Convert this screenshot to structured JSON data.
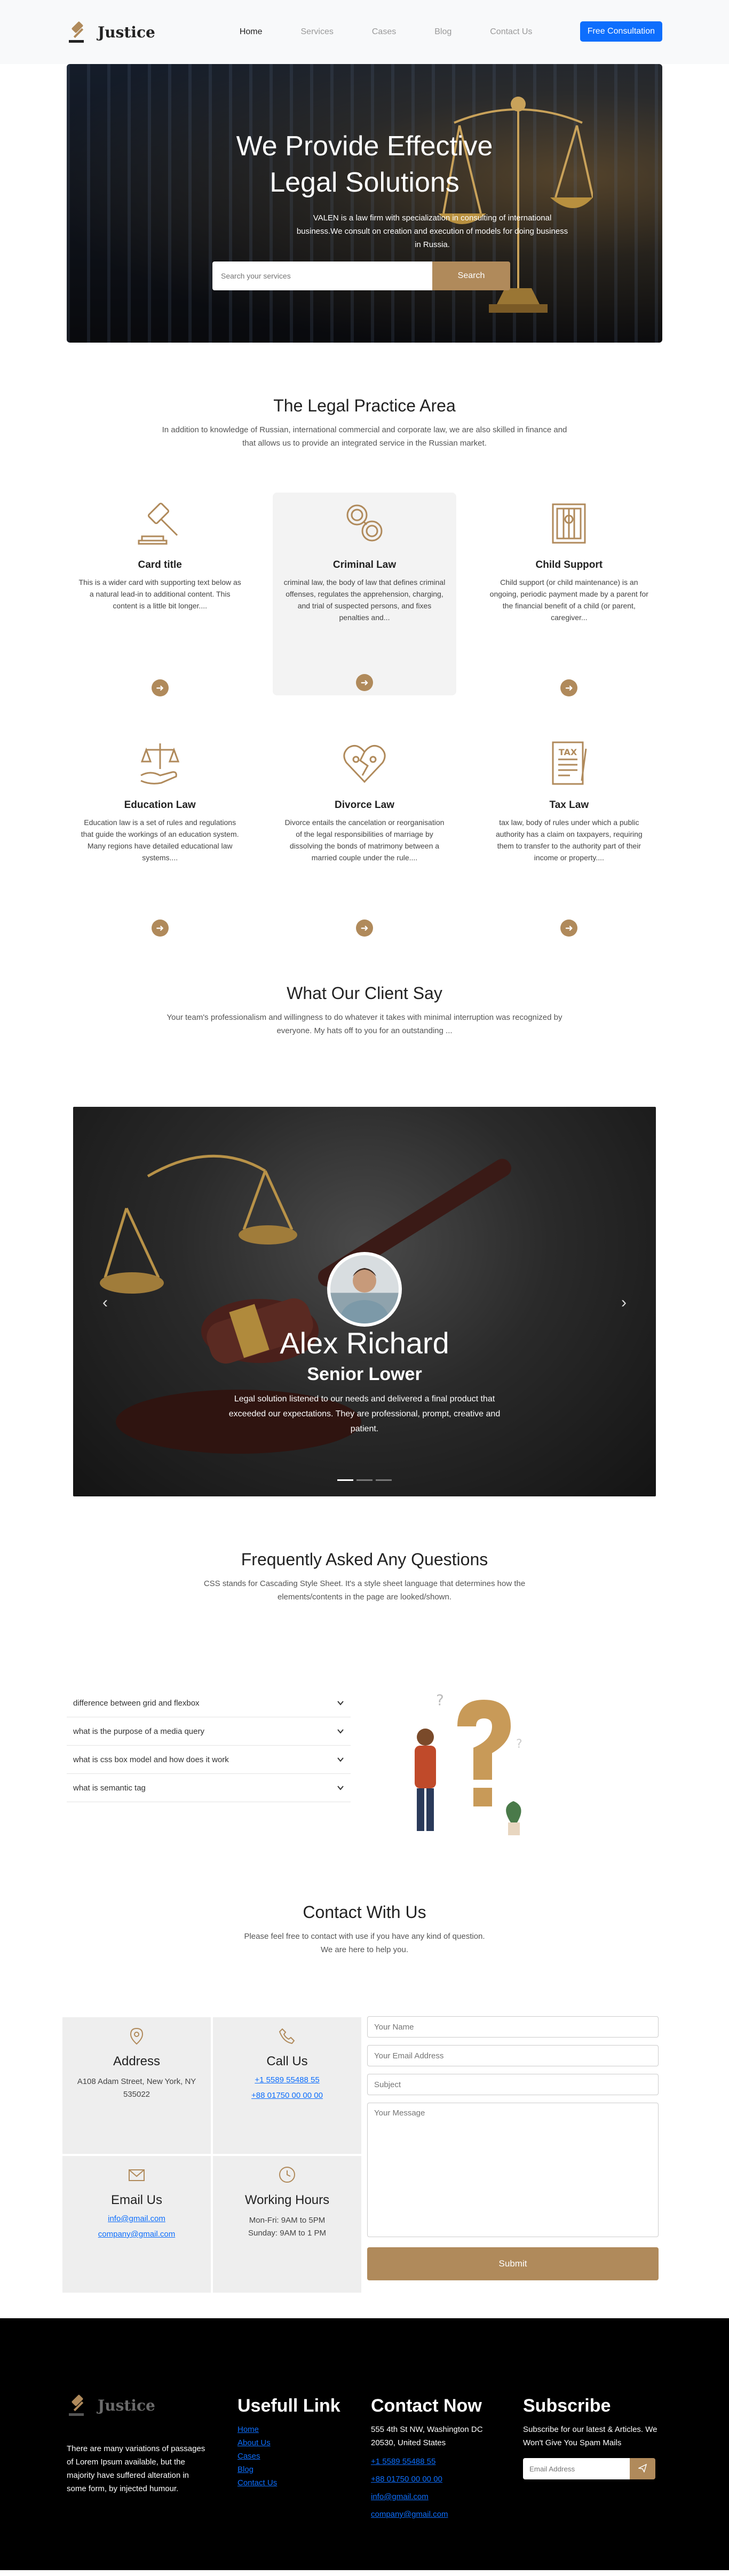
{
  "nav": {
    "brand": "Justice",
    "links": [
      "Home",
      "Services",
      "Cases",
      "Blog",
      "Contact Us"
    ],
    "cta": "Free Consultation"
  },
  "hero": {
    "title_line1": "We Provide Effective",
    "title_line2": "Legal Solutions",
    "text": "VALEN is a law firm with specialization in consulting of international business.We consult on creation and execution of models for doing business in Russia.",
    "search_placeholder": "Search your services",
    "search_button": "Search"
  },
  "practice": {
    "title": "The Legal Practice Area",
    "subtitle": "In addition to knowledge of Russian, international commercial and corporate law, we are also skilled in finance and that allows us to provide an integrated service in the Russian market.",
    "cards": [
      {
        "title": "Card title",
        "text": "This is a wider card with supporting text below as a natural lead-in to additional content. This content is a little bit longer....",
        "icon": "gavel-icon"
      },
      {
        "title": "Criminal Law",
        "text": "criminal law, the body of law that defines criminal offenses, regulates the apprehension, charging, and trial of suspected persons, and fixes penalties and...",
        "icon": "handcuffs-icon"
      },
      {
        "title": "Child Support",
        "text": "Child support (or child maintenance) is an ongoing, periodic payment made by a parent for the financial benefit of a child (or parent, caregiver...",
        "icon": "prison-icon"
      },
      {
        "title": "Education Law",
        "text": "Education law is a set of rules and regulations that guide the workings of an education system. Many regions have detailed educational law systems....",
        "icon": "hand-scale-icon"
      },
      {
        "title": "Divorce Law",
        "text": "Divorce entails the cancelation or reorganisation of the legal responsibilities of marriage by dissolving the bonds of matrimony between a married couple under the rule....",
        "icon": "broken-heart-icon"
      },
      {
        "title": "Tax Law",
        "text": "tax law, body of rules under which a public authority has a claim on taxpayers, requiring them to transfer to the authority part of their income or property....",
        "icon": "tax-document-icon"
      }
    ],
    "arrow": "➜"
  },
  "testimonial": {
    "title": "What Our Client Say",
    "subtitle": "Your team's professionalism and willingness to do whatever it takes with minimal interruption was recognized by everyone. My hats off to you for an outstanding ...",
    "name": "Alex Richard",
    "role": "Senior Lower",
    "quote": "Legal solution listened to our needs and delivered a final product that exceeded our expectations. They are professional, prompt, creative and patient.",
    "prev": "‹",
    "next": "›",
    "active_slide": 1,
    "slide_count": 3
  },
  "faq": {
    "title": "Frequently Asked Any Questions",
    "subtitle": "CSS stands for Cascading Style Sheet. It's a style sheet language that determines how the elements/contents in the page are looked/shown.",
    "items": [
      "difference between grid and flexbox",
      "what is the purpose of a media query",
      "what is css box model and how does it work",
      "what is semantic tag"
    ]
  },
  "contact": {
    "title": "Contact With Us",
    "subtitle_line1": "Please feel free to contact with use if you have any kind of question.",
    "subtitle_line2": "We are here to help you.",
    "address_title": "Address",
    "address": "A108 Adam Street, New York, NY 535022",
    "call_title": "Call Us",
    "phone1": "+1 5589 55488 55",
    "phone2": "+88 01750 00 00 00",
    "email_title": "Email Us",
    "email1": "info@gmail.com",
    "email2": "company@gmail.com",
    "hours_title": "Working Hours",
    "hours1": "Mon-Fri: 9AM to 5PM",
    "hours2": "Sunday: 9AM to 1 PM",
    "form": {
      "name": "Your Name",
      "email": "Your Email Address",
      "subject": "Subject",
      "message": "Your Message",
      "submit": "Submit"
    }
  },
  "footer": {
    "brand": "Justice",
    "blurb": "There are many variations of passages of Lorem Ipsum available, but the majority have suffered alteration in some form, by injected humour.",
    "useful_title": "Usefull Link",
    "useful_links": [
      "Home",
      "About Us",
      "Cases",
      "Blog",
      "Contact Us"
    ],
    "contact_title": "Contact Now",
    "contact_address": "555 4th St NW, Washington DC 20530, United States",
    "contact_phone1": "+1 5589 55488 55",
    "contact_phone2": "+88 01750 00 00 00",
    "contact_email1": "info@gmail.com",
    "contact_email2": "company@gmail.com",
    "subscribe_title": "Subscribe",
    "subscribe_text": "Subscribe for our latest & Articles. We Won't Give You Spam Mails",
    "subscribe_placeholder": "Email Address"
  },
  "colors": {
    "accent": "#b08a5b",
    "primary": "#0d6efd",
    "footer_bg": "#000000"
  }
}
